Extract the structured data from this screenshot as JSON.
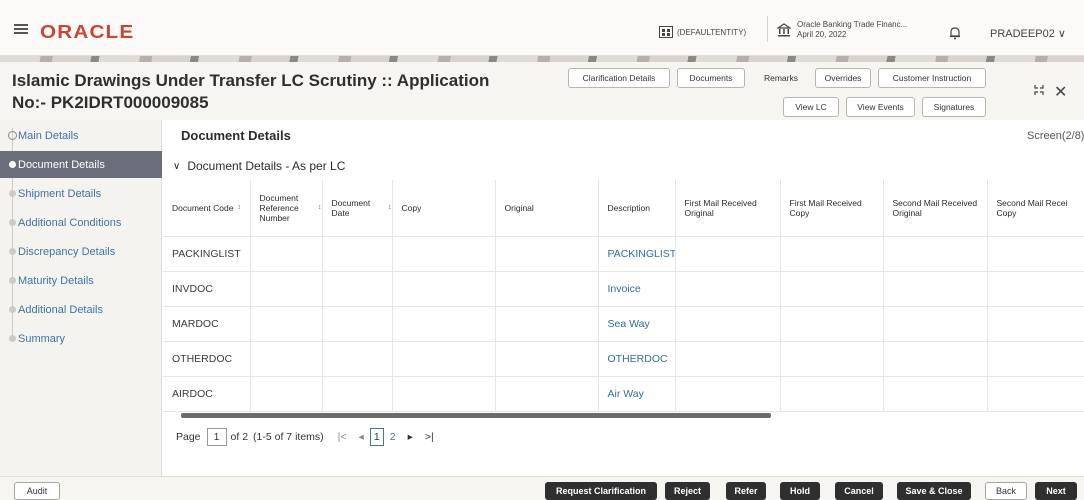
{
  "topbar": {
    "brand": "ORACLE",
    "entity": "(DEFAULTENTITY)",
    "bank_name": "Oracle Banking Trade Financ...",
    "bank_date": "April 20, 2022",
    "user": "PRADEEP02"
  },
  "header": {
    "title_line1": "Islamic Drawings Under Transfer LC Scrutiny :: Application",
    "title_line2": "No:- PK2IDRT000009085",
    "buttons": {
      "clarification": "Clarification Details",
      "documents": "Documents",
      "remarks": "Remarks",
      "overrides": "Overrides",
      "customer_instruction": "Customer Instruction",
      "view_lc": "View LC",
      "view_events": "View Events",
      "signatures": "Signatures"
    }
  },
  "sidebar": {
    "items": [
      {
        "label": "Main Details"
      },
      {
        "label": "Document Details"
      },
      {
        "label": "Shipment Details"
      },
      {
        "label": "Additional Conditions"
      },
      {
        "label": "Discrepancy Details"
      },
      {
        "label": "Maturity Details"
      },
      {
        "label": "Additional Details"
      },
      {
        "label": "Summary"
      }
    ]
  },
  "main": {
    "section_title": "Document Details",
    "screen": "Screen(2/8)",
    "subsection": "Document Details - As per LC",
    "columns": [
      "Document Code",
      "Document Reference Number",
      "Document Date",
      "Copy",
      "Original",
      "Description",
      "First Mail Received Original",
      "First Mail Received Copy",
      "Second Mail Received Original",
      "Second Mail Recei Copy"
    ],
    "rows": [
      {
        "code": "PACKINGLIST",
        "description": "PACKINGLIST"
      },
      {
        "code": "INVDOC",
        "description": "Invoice"
      },
      {
        "code": "MARDOC",
        "description": "Sea Way"
      },
      {
        "code": "OTHERDOC",
        "description": "OTHERDOC"
      },
      {
        "code": "AIRDOC",
        "description": "Air Way"
      }
    ],
    "pager": {
      "page_label": "Page",
      "page_value": "1",
      "of_label": "of 2",
      "items_label": "(1-5 of 7 items)",
      "page1": "1",
      "page2": "2"
    }
  },
  "footer": {
    "audit": "Audit",
    "request_clarification": "Request Clarification",
    "reject": "Reject",
    "refer": "Refer",
    "hold": "Hold",
    "cancel": "Cancel",
    "save_close": "Save & Close",
    "back": "Back",
    "next": "Next"
  },
  "colors": {
    "brand": "#c74634",
    "link": "#2f6d9e",
    "active_nav": "#6a6e7a",
    "dark_button": "#2f2f2f"
  }
}
